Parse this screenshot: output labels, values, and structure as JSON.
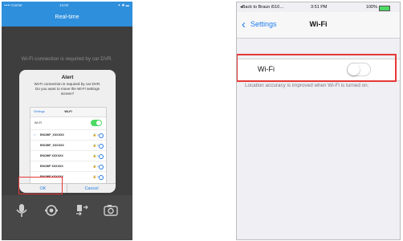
{
  "left_phone": {
    "status": {
      "left": "••••• Carrier",
      "time": "14:02",
      "right": "✦ ✱ ▬"
    },
    "nav_title": "Real-time",
    "background_message": "Wi-Fi connection is required by car DVR.",
    "alert": {
      "title": "Alert",
      "message": "Wi-Fi connection is required by car DVR. Do you want to move the Wi-Fi settings screen?",
      "mini_settings": {
        "back_label": "Settings",
        "title": "Wi-Fi",
        "wifi_row_label": "Wi-Fi",
        "networks": [
          {
            "name": "ENOWF_XXXXXX",
            "selected": true
          },
          {
            "name": "ENOWF_XXXXXX",
            "selected": false
          },
          {
            "name": "ENOWF XXXXXX",
            "selected": false
          },
          {
            "name": "ENOWF XXXXXX",
            "selected": false
          },
          {
            "name": "ENOWF XXXXXX",
            "selected": false
          }
        ],
        "signal_glyph": "🔒 ≈"
      },
      "ok_label": "OK",
      "cancel_label": "Cancel"
    },
    "toolbar_icons": [
      "microphone-icon",
      "camera-icon",
      "sync-icon",
      "photo-camera-icon"
    ],
    "bottom_labels": [
      "",
      "",
      ""
    ],
    "colors": {
      "nav": "#2e8fdc",
      "link": "#2a7de1",
      "highlight": "#e53935"
    }
  },
  "right_phone": {
    "status": {
      "left": "◂Back to Braun i510…",
      "time": "3:51 PM",
      "battery_text": "100%"
    },
    "nav_back_label": "Settings",
    "nav_title": "Wi-Fi",
    "wifi_label": "Wi-Fi",
    "wifi_enabled": false,
    "note": "Location accuracy is improved when Wi-Fi is turned on.",
    "colors": {
      "link": "#1e7cf2",
      "highlight": "#e53935"
    }
  }
}
